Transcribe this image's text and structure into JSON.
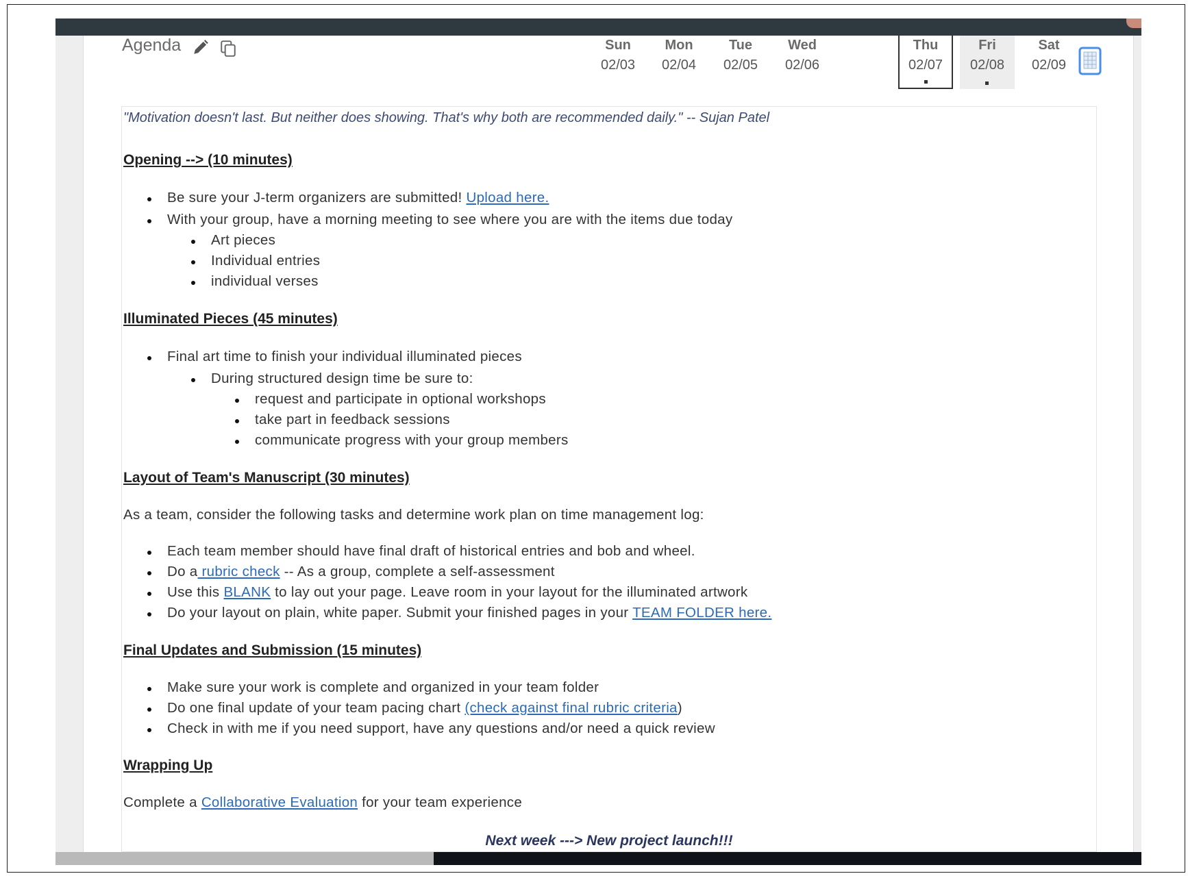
{
  "header": {
    "title": "Agenda",
    "edit_icon": "pencil-icon",
    "copy_icon": "copy-icon",
    "calendar_icon": "calendar-icon",
    "days": [
      {
        "name": "Sun",
        "date": "02/03"
      },
      {
        "name": "Mon",
        "date": "02/04"
      },
      {
        "name": "Tue",
        "date": "02/05"
      },
      {
        "name": "Wed",
        "date": "02/06"
      },
      {
        "name": "Thu",
        "date": "02/07"
      },
      {
        "name": "Fri",
        "date": "02/08"
      },
      {
        "name": "Sat",
        "date": "02/09"
      }
    ]
  },
  "content": {
    "quote": "\"Motivation doesn't last. But neither does showing. That's why both are recommended daily.\" -- Sujan Patel",
    "opening": {
      "heading": "Opening --> (10 minutes)",
      "bullet1_text": "Be sure your J-term organizers are submitted! ",
      "bullet1_link": "Upload here.",
      "bullet2": "With your group, have a morning meeting to see where you are with the items due today",
      "sub": [
        "Art pieces",
        "Individual entries",
        "individual verses"
      ]
    },
    "illuminated": {
      "heading": " Illuminated Pieces (45 minutes)",
      "bullet1": "Final art time to finish your individual illuminated pieces",
      "sub1": "During structured design time be sure to:",
      "sub2": [
        "request and participate in optional workshops",
        "take part in feedback sessions",
        "communicate progress with your group members"
      ]
    },
    "layout": {
      "heading": "Layout of Team's Manuscript (30 minutes)",
      "intro": "As a team, consider the following tasks and determine work plan on time management log:",
      "b1": "Each team member should have final draft of historical entries and bob and wheel.",
      "b2_pre": "Do a",
      "b2_link": " rubric check",
      "b2_post": "  -- As a group, complete a self-assessment",
      "b3_pre": "Use this ",
      "b3_link": "BLANK",
      "b3_post": " to lay out your page. Leave room in your layout for the illuminated artwork",
      "b4_pre": "Do your layout on plain, white paper. Submit your finished pages in your ",
      "b4_link": "TEAM FOLDER here."
    },
    "final": {
      "heading": "Final Updates and Submission (15 minutes)",
      "b1": "Make sure your work is complete and organized in your team folder",
      "b2_pre": "Do one final update of your team pacing chart  ",
      "b2_link": "(check against final rubric criteria",
      "b2_post": ")",
      "b3": "Check in with me if you need support, have any questions and/or need a quick review"
    },
    "wrap": {
      "heading": "Wrapping Up",
      "pre": "Complete a ",
      "link": "Collaborative Evaluation",
      "post": " for your team experience"
    },
    "next_week": "Next week ---> New project launch!!!"
  }
}
